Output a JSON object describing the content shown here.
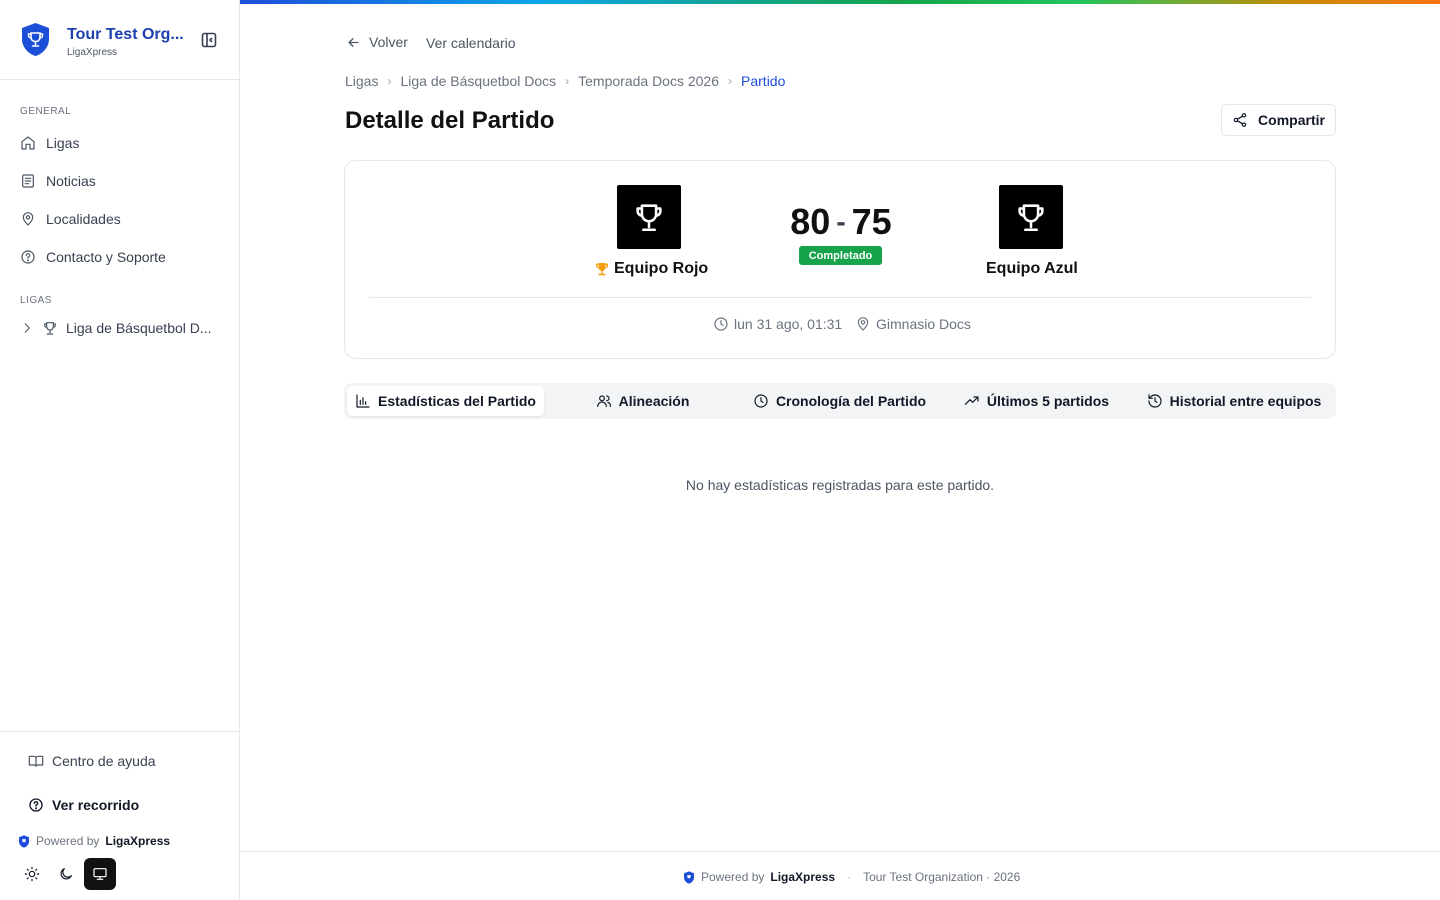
{
  "app": {
    "org_name": "Tour Test Org...",
    "org_sub": "LigaXpress",
    "brand_color": "#1d4ed8"
  },
  "sidebar": {
    "general_label": "GENERAL",
    "items": [
      {
        "label": "Ligas",
        "icon": "home-icon"
      },
      {
        "label": "Noticias",
        "icon": "newspaper-icon"
      },
      {
        "label": "Localidades",
        "icon": "map-pin-icon"
      },
      {
        "label": "Contacto y Soporte",
        "icon": "help-circle-icon"
      }
    ],
    "leagues_label": "LIGAS",
    "league": "Liga de Básquetbol D...",
    "help": "Centro de ayuda",
    "tour": "Ver recorrido",
    "powered_prefix": "Powered by",
    "powered_brand": "LigaXpress"
  },
  "nav": {
    "back": "Volver",
    "calendar": "Ver calendario"
  },
  "breadcrumb": [
    "Ligas",
    "Liga de Básquetbol Docs",
    "Temporada Docs 2026",
    "Partido"
  ],
  "page_title": "Detalle del Partido",
  "share_label": "Compartir",
  "match": {
    "home_team": "Equipo Rojo",
    "away_team": "Equipo Azul",
    "home_score": "80",
    "away_score": "75",
    "separator": "-",
    "status": "Completado",
    "status_color": "#16a34a",
    "date": "lun 31 ago, 01:31",
    "venue": "Gimnasio Docs"
  },
  "tabs": [
    {
      "label": "Estadísticas del Partido",
      "icon": "bar-chart-icon"
    },
    {
      "label": "Alineación",
      "icon": "users-icon"
    },
    {
      "label": "Cronología del Partido",
      "icon": "clock-icon"
    },
    {
      "label": "Últimos 5 partidos",
      "icon": "trending-up-icon"
    },
    {
      "label": "Historial entre equipos",
      "icon": "history-icon"
    }
  ],
  "empty_message": "No hay estadísticas registradas para este partido.",
  "footer": {
    "powered_prefix": "Powered by",
    "powered_brand": "LigaXpress",
    "org": "Tour Test Organization · 2026"
  }
}
